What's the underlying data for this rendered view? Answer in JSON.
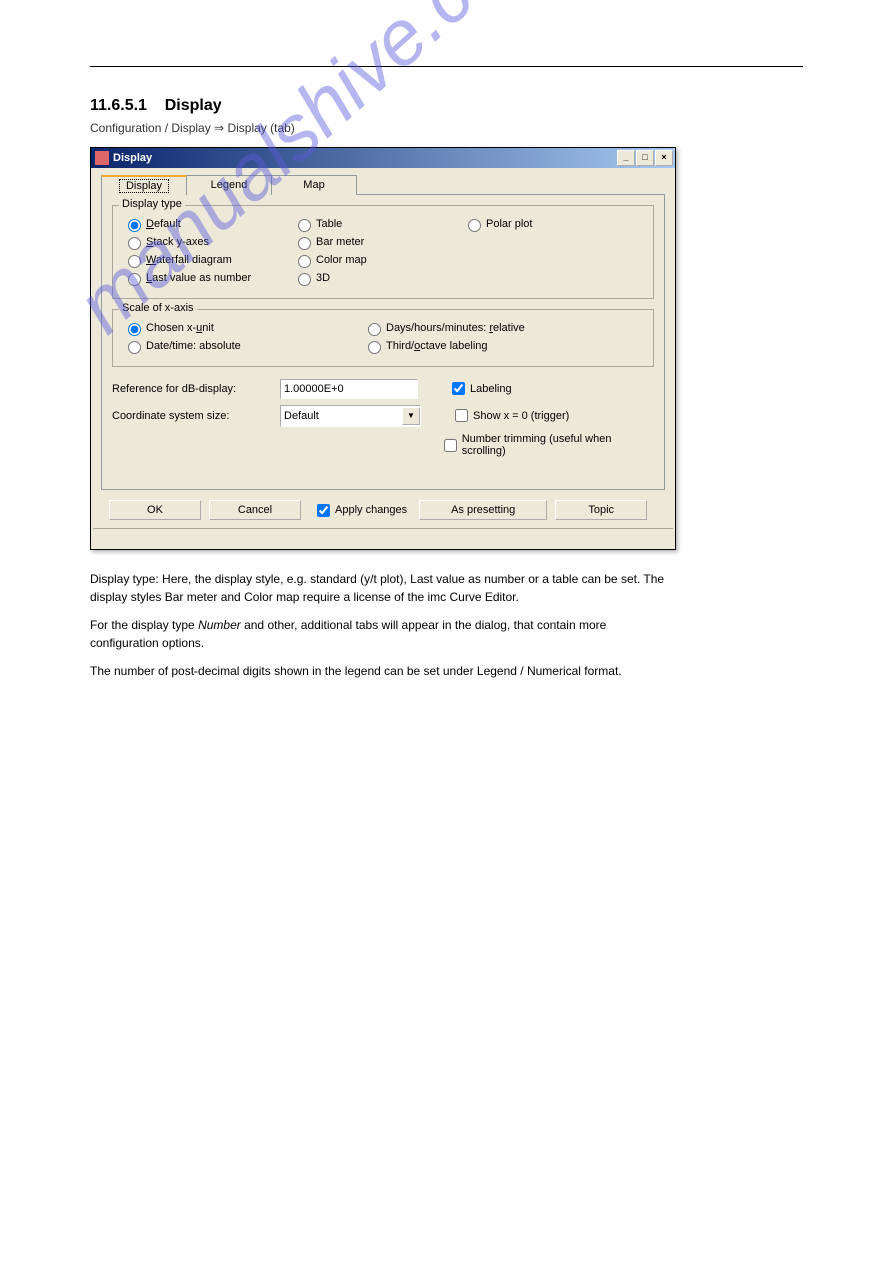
{
  "page": {
    "section_number": "11.6.5.1",
    "section_title": "Display",
    "nav_path": "Configuration / Display ⇒ Display (tab)",
    "watermark": "manualshive.com"
  },
  "dialog": {
    "title": "Display",
    "winbtns": {
      "min": "_",
      "max": "□",
      "close": "×"
    },
    "tabs": [
      {
        "label": "Display",
        "active": true
      },
      {
        "label": "Legend",
        "active": false
      },
      {
        "label": "Map",
        "active": false
      }
    ],
    "group_display_type": {
      "legend": "Display type",
      "col1": [
        {
          "label": "Default",
          "accel": "D",
          "checked": true
        },
        {
          "label": "Stack y-axes",
          "accel": "S",
          "checked": false
        },
        {
          "label": "Waterfall diagram",
          "accel": "W",
          "checked": false
        },
        {
          "label": "Last value as number",
          "accel": "L",
          "checked": false
        }
      ],
      "col2": [
        {
          "label": "Table",
          "checked": false
        },
        {
          "label": "Bar meter",
          "checked": false
        },
        {
          "label": "Color map",
          "checked": false
        },
        {
          "label": "3D",
          "checked": false
        }
      ],
      "col3": [
        {
          "label": "Polar plot",
          "checked": false
        }
      ]
    },
    "group_scale_x": {
      "legend": "Scale of x-axis",
      "left": [
        {
          "label": "Chosen x-unit",
          "accel": "u",
          "checked": true
        },
        {
          "label": "Date/time: absolute",
          "checked": false
        }
      ],
      "right": [
        {
          "label": "Days/hours/minutes: relative",
          "accel": "r",
          "checked": false
        },
        {
          "label": "Third/octave labeling",
          "accel": "o",
          "checked": false
        }
      ]
    },
    "ref_db_label": "Reference for dB-display:",
    "ref_db_value": "1.00000E+0",
    "coord_size_label": "Coordinate system size:",
    "coord_size_value": "Default",
    "chk_labeling": "Labeling",
    "chk_showx0": "Show x = 0 (trigger)",
    "chk_numtrim": "Number trimming (useful when scrolling)",
    "buttons": {
      "ok": "OK",
      "cancel": "Cancel",
      "apply": "Apply changes",
      "preset": "As presetting",
      "topic": "Topic"
    }
  },
  "body": {
    "p1": "Display type: Here, the display style, e.g. standard (y/t plot), Last value as number or a table can be set. The display styles Bar meter and Color map require a license of the imc Curve Editor.",
    "p2_a": "For the display type ",
    "p2_em": "Number",
    "p2_b": " and other, additional tabs will appear in the dialog, that contain more configuration options.",
    "p3": "The number of post-decimal digits shown in the legend can be set under Legend / Numerical format."
  }
}
